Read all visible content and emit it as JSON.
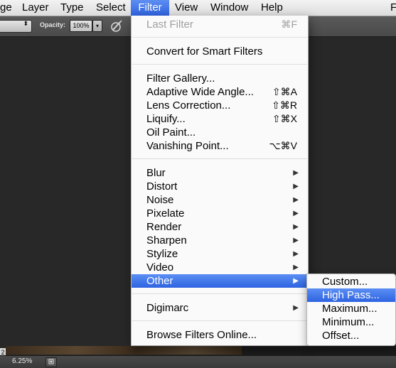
{
  "menubar": {
    "items": [
      "ge",
      "Layer",
      "Type",
      "Select",
      "Filter",
      "View",
      "Window",
      "Help",
      "F"
    ]
  },
  "options_bar": {
    "opacity_label": "Opacity:",
    "opacity_value": "100%",
    "stepper_arrows": "⬍",
    "dropdown_arrow": "▾",
    "brush_icon": "airbrush-icon"
  },
  "status_bar": {
    "zoom": "6.25%",
    "side_number": "2"
  },
  "filter_menu": {
    "last_filter": {
      "label": "Last Filter",
      "shortcut": "⌘F"
    },
    "convert": {
      "label": "Convert for Smart Filters"
    },
    "filter_gallery": {
      "label": "Filter Gallery..."
    },
    "adaptive_wide_angle": {
      "label": "Adaptive Wide Angle...",
      "shortcut": "⇧⌘A"
    },
    "lens_correction": {
      "label": "Lens Correction...",
      "shortcut": "⇧⌘R"
    },
    "liquify": {
      "label": "Liquify...",
      "shortcut": "⇧⌘X"
    },
    "oil_paint": {
      "label": "Oil Paint..."
    },
    "vanishing_point": {
      "label": "Vanishing Point...",
      "shortcut": "⌥⌘V"
    },
    "submenus": [
      "Blur",
      "Distort",
      "Noise",
      "Pixelate",
      "Render",
      "Sharpen",
      "Stylize",
      "Video",
      "Other"
    ],
    "digimarc": {
      "label": "Digimarc"
    },
    "browse": {
      "label": "Browse Filters Online..."
    },
    "arrow_glyph": "▶"
  },
  "other_submenu": {
    "items": [
      "Custom...",
      "High Pass...",
      "Maximum...",
      "Minimum...",
      "Offset..."
    ],
    "highlighted": "High Pass..."
  },
  "colors": {
    "highlight": "#2d63e1",
    "menu_bg": "#fafafa",
    "workspace": "#282828"
  }
}
